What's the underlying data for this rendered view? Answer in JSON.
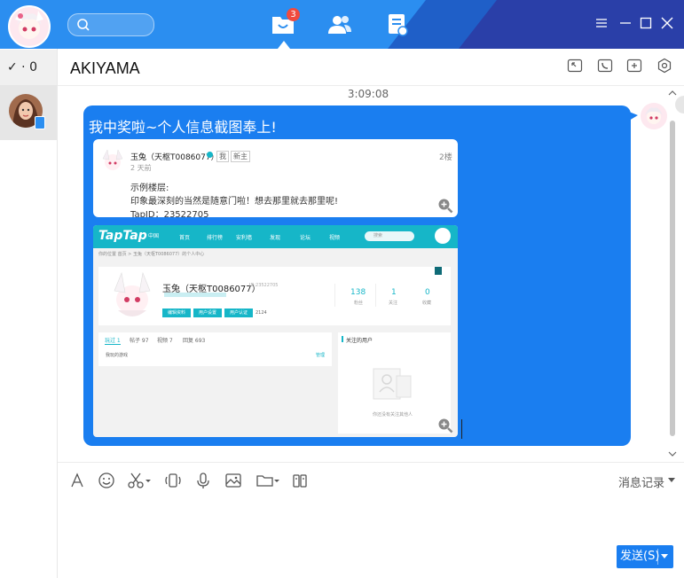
{
  "window": {
    "notification_count": "3",
    "chat_title": "AKIYAMA",
    "status_count": "0",
    "status_label": "✓ · 0"
  },
  "message": {
    "timestamp": "3:09:08",
    "text": "我中奖啦~个人信息截图奉上!",
    "card1": {
      "name": "玉兔（天枢T0086077）",
      "tag_me": "我",
      "tag_new": "新主",
      "floor": "2楼",
      "time": "2 天前",
      "line1": "示例楼层:",
      "line2": "印象最深刻的当然是随意门啦！想去那里就去那里呢!",
      "line3": "TapID：23522705"
    },
    "card2": {
      "logo": "TapTap",
      "logo_suffix": "中国",
      "nav": [
        "首页",
        "排行榜",
        "安利墙",
        "发现",
        "论坛",
        "视频"
      ],
      "search_placeholder": "搜索",
      "breadcrumb": "你的位置  首页 > 玉兔（天枢T0086077）的个人中心",
      "profile_name": "玉兔（天枢T0086077）",
      "profile_id": "ID:23522705",
      "stats": [
        {
          "value": "138",
          "label": "粉丝"
        },
        {
          "value": "1",
          "label": "关注"
        },
        {
          "value": "0",
          "label": "收藏"
        }
      ],
      "buttons": [
        "编辑资料",
        "用户设置",
        "用户认证"
      ],
      "points": "2124",
      "tabs": [
        "玩过 1",
        "帖子 97",
        "视频 7",
        "回复 693"
      ],
      "played_label": "我玩的游戏",
      "manage_label": "管理",
      "following_title": "关注的用户",
      "empty_text": "你还没有关注其他人"
    }
  },
  "toolbar": {
    "history_label": "消息记录",
    "send_label": "发送(S)"
  },
  "colors": {
    "topbar": "#2b8ef0",
    "bubble": "#1a7ef0",
    "taptap_teal": "#16b6c8",
    "badge": "#f04a3e"
  },
  "icons": [
    "search-icon",
    "chat-icon",
    "contacts-icon",
    "notes-icon",
    "menu-icon",
    "minimize-icon",
    "maximize-icon",
    "close-icon",
    "screenshot-icon",
    "phone-icon",
    "add-icon",
    "settings-icon",
    "font-icon",
    "emoji-icon",
    "scissors-icon",
    "shake-icon",
    "voice-icon",
    "image-icon",
    "folder-icon",
    "more-icon"
  ]
}
